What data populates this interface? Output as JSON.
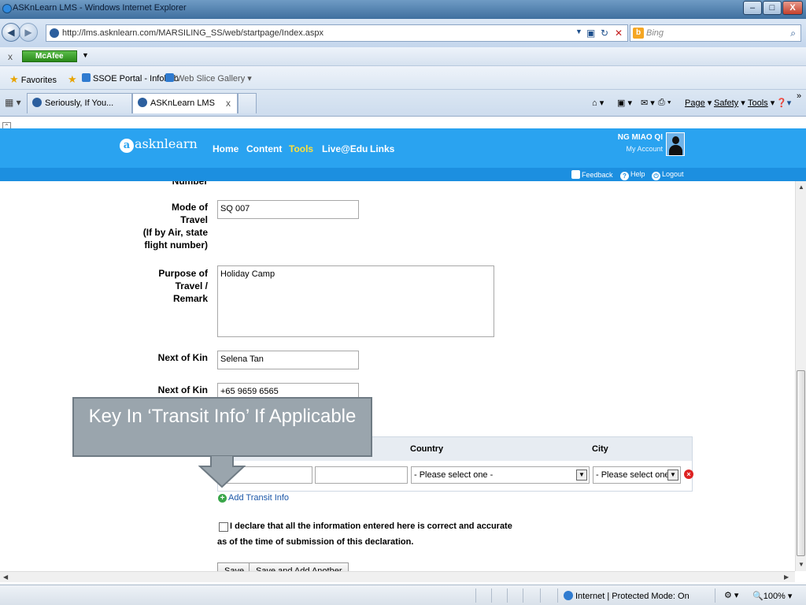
{
  "window": {
    "title": "ASKnLearn LMS - Windows Internet Explorer",
    "buttons": {
      "minimize": "–",
      "maximize": "□",
      "close": "X"
    }
  },
  "address": {
    "url": "http://lms.asknlearn.com/MARSILING_SS/web/startpage/Index.aspx",
    "search_placeholder": "Bing"
  },
  "mcafee": {
    "label": "McAfee"
  },
  "favorites": {
    "label": "Favorites",
    "items": [
      "SSOE Portal - Infohub",
      "Web Slice Gallery"
    ]
  },
  "tabs": [
    {
      "label": "Seriously, If You..."
    },
    {
      "label": "ASKnLearn LMS"
    }
  ],
  "commands": {
    "page": "Page",
    "safety": "Safety",
    "tools": "Tools"
  },
  "lms": {
    "logo": "asknlearn",
    "logo_initial": "a",
    "nav": [
      "Home",
      "Content",
      "Tools",
      "Live@Edu",
      "Links"
    ],
    "user_name": "NG MIAO QI",
    "my_account": "My Account",
    "sublinks": {
      "feedback": "Feedback",
      "help": "Help",
      "logout": "Logout"
    }
  },
  "form": {
    "number_label_fragment": "Number",
    "mode_of_travel_label": "Mode of Travel (If by Air, state flight number)",
    "mode_of_travel_lines": [
      "Mode of",
      "Travel",
      "(If by Air, state",
      "flight number)"
    ],
    "mode_of_travel_value": "SQ 007",
    "purpose_lines": [
      "Purpose of",
      "Travel /",
      "Remark"
    ],
    "purpose_value": "Holiday Camp",
    "next_of_kin_label": "Next of Kin",
    "next_of_kin_value": "Selena Tan",
    "next_of_kin_contact_label": "Next of Kin",
    "next_of_kin_contact_value": "+65 9659 6565",
    "transit": {
      "col_country": "Country",
      "col_city": "City",
      "country_select": "- Please select one -",
      "city_select": "- Please select one -"
    },
    "add_transit": "Add Transit Info",
    "declaration_line1": "I declare that all the information entered here is correct and accurate",
    "declaration_line2": "as of the time of submission of this declaration.",
    "save": "Save",
    "save_add_another": "Save and Add Another"
  },
  "callout": {
    "text": "Key In ‘Transit Info’ If Applicable"
  },
  "status": {
    "zone": "Internet | Protected Mode: On",
    "zoom": "100%"
  },
  "colors": {
    "header_blue": "#2aa3f0",
    "subbar_blue": "#1c8fe0",
    "active_nav": "#ffe03a",
    "callout_gray": "#9aa5ad"
  }
}
